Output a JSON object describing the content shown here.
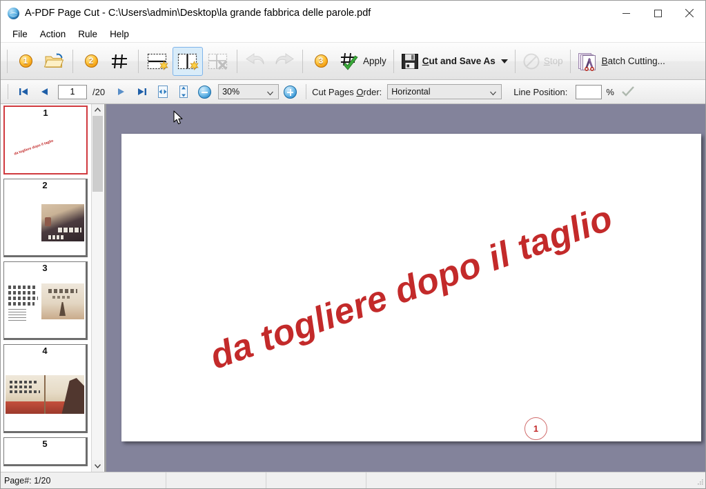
{
  "window": {
    "title": "A-PDF Page Cut - C:\\Users\\admin\\Desktop\\la grande fabbrica delle parole.pdf",
    "app_icon": "globe-icon",
    "minimize_label": "─",
    "maximize_label": "□",
    "close_label": "✕"
  },
  "menubar": {
    "items": [
      {
        "label": "File"
      },
      {
        "label": "Action"
      },
      {
        "label": "Rule"
      },
      {
        "label": "Help"
      }
    ]
  },
  "toolbar": {
    "step1_badge": "1",
    "open_icon": "open-folder-icon",
    "step2_badge": "2",
    "grid_icon": "grid-icon",
    "add_horizontal_line_icon": "add-horizontal-cut-line-icon",
    "add_vertical_line_icon": "add-vertical-cut-line-icon",
    "delete_line_icon": "delete-cut-line-icon",
    "undo_icon": "undo-arrow-icon",
    "redo_icon": "redo-arrow-icon",
    "step3_badge": "3",
    "apply_icon": "apply-grid-check-icon",
    "apply_label": "Apply",
    "save_icon": "floppy-disk-icon",
    "save_label_prefix": "C",
    "save_label_rest": "ut and Save As",
    "save_dropdown": "chevron-down-icon",
    "stop_icon": "stop-circle-icon",
    "stop_label_prefix": "S",
    "stop_label_rest": "top",
    "batch_icon": "batch-scissors-icon",
    "batch_label_prefix": "B",
    "batch_label_rest": "atch Cutting..."
  },
  "navbar": {
    "first_page_icon": "first-page-icon",
    "prev_page_icon": "previous-page-icon",
    "page_value": "1",
    "page_total": "/20",
    "next_page_icon": "next-page-icon",
    "last_page_icon": "last-page-icon",
    "fit_width_icon": "fit-width-icon",
    "fit_height_icon": "fit-height-icon",
    "zoom_out_icon": "zoom-out-icon",
    "zoom_value": "30%",
    "zoom_in_icon": "zoom-in-icon",
    "cut_order_label_prefix": "Cut Pages ",
    "cut_order_label_key": "O",
    "cut_order_label_suffix": "rder:",
    "cut_order_value": "Horizontal",
    "line_position_label": "Line Position:",
    "line_position_value": "",
    "percent_label": "%",
    "confirm_icon": "check-mark-icon"
  },
  "thumbnails": {
    "items": [
      {
        "number": "1",
        "selected": true,
        "caption": "da togliere dopo il taglio"
      },
      {
        "number": "2",
        "selected": false,
        "caption": ""
      },
      {
        "number": "3",
        "selected": false,
        "caption": ""
      },
      {
        "number": "4",
        "selected": false,
        "caption": ""
      },
      {
        "number": "5",
        "selected": false,
        "caption": ""
      }
    ],
    "scroll_up_icon": "chevron-up-icon",
    "scroll_down_icon": "chevron-down-icon"
  },
  "viewer": {
    "page_text": "da togliere dopo il taglio",
    "cut_marker_label": "1"
  },
  "statusbar": {
    "page_info": "Page#: 1/20",
    "cell2": "",
    "cell3": "",
    "cell4": "",
    "cell5": ""
  },
  "colors": {
    "accent_orange": "#f0950c",
    "accent_blue": "#2f8fd0",
    "selection_red": "#d0393e",
    "doc_red": "#c32a2a",
    "viewer_bg": "#83839b",
    "toolbar_selected": "#d9ecf9"
  }
}
